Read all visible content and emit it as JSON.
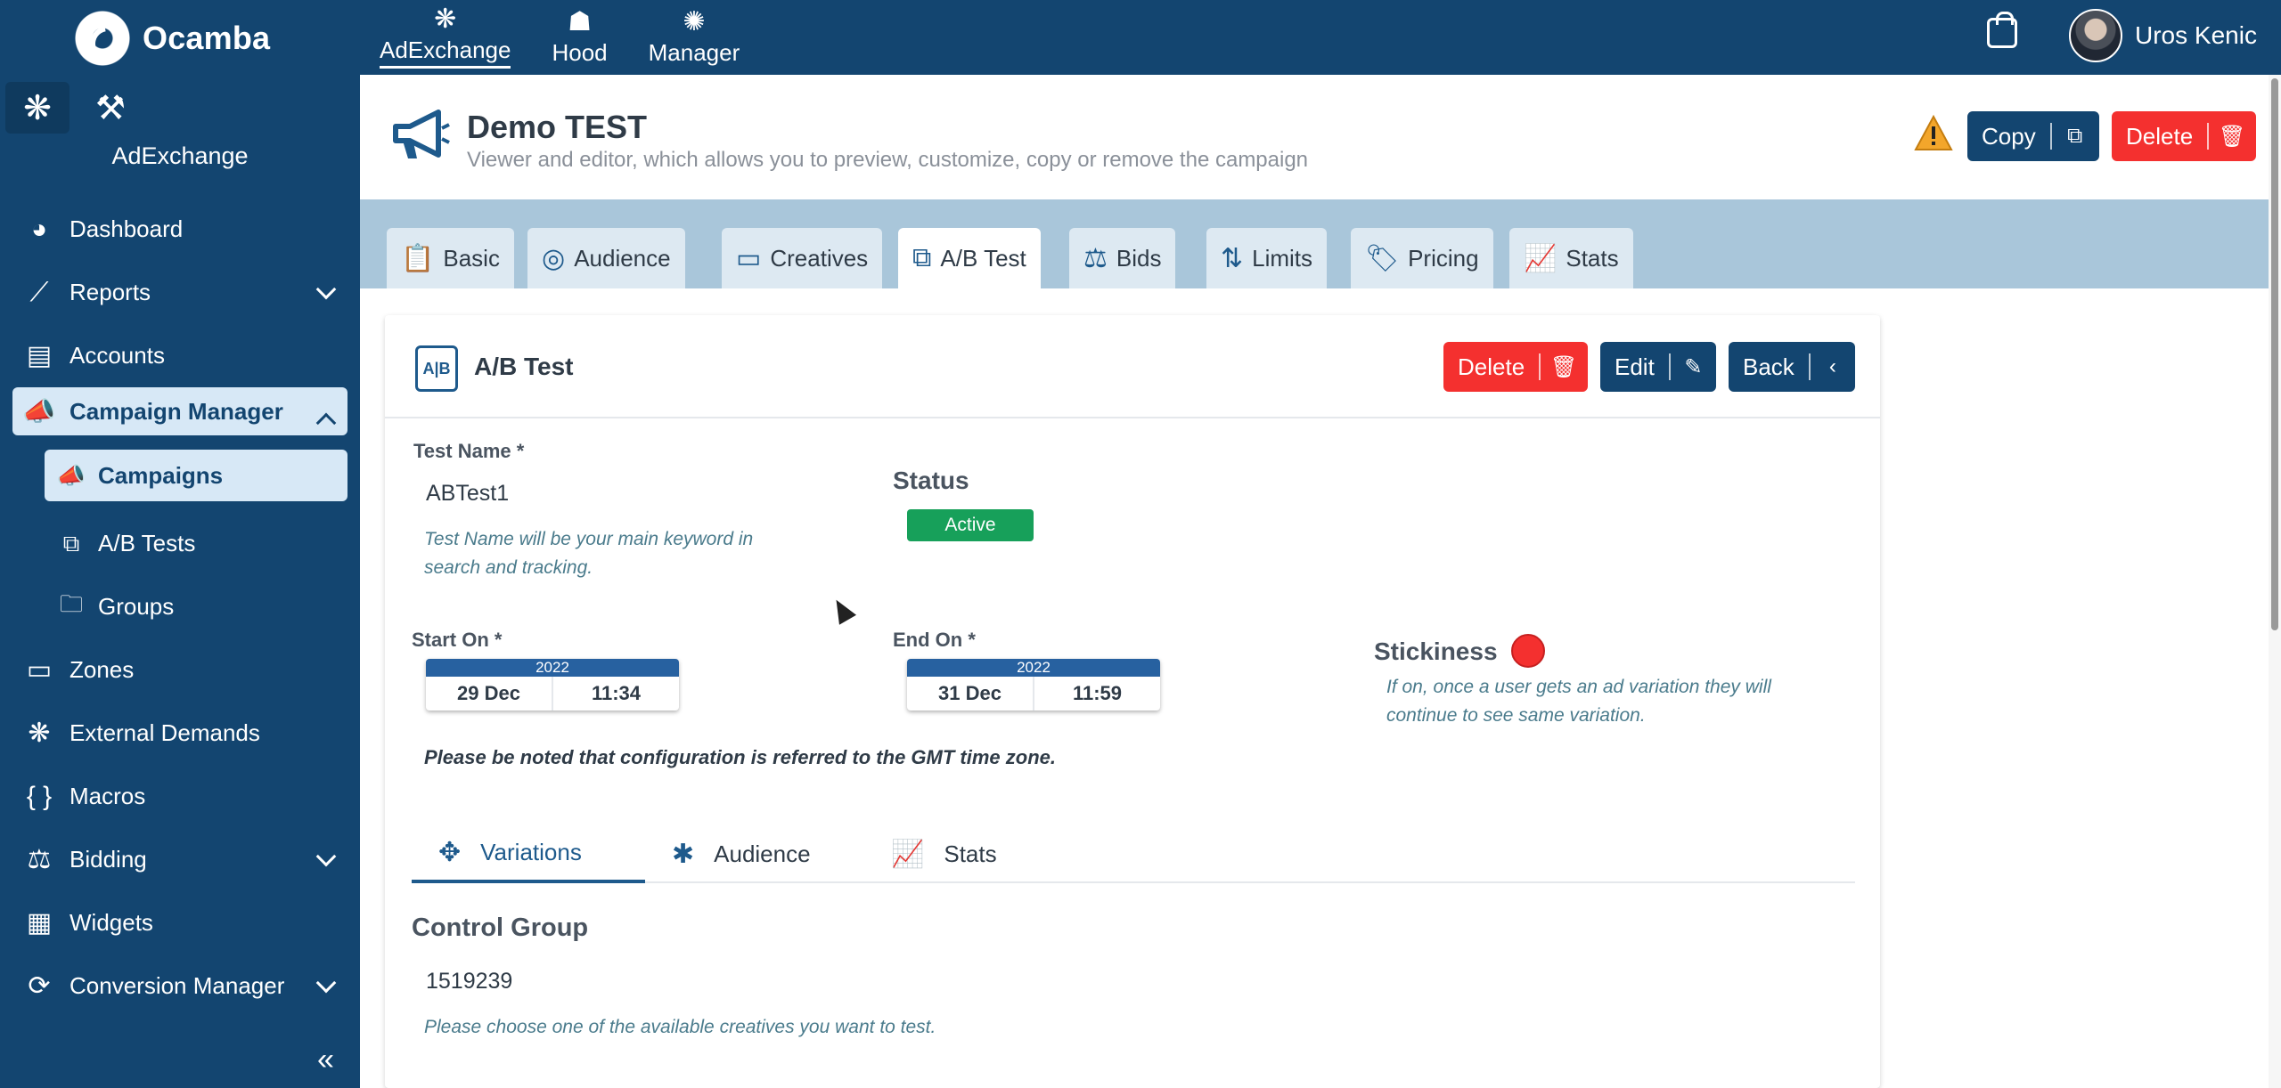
{
  "app": {
    "name": "Ocamba"
  },
  "top_nav": [
    {
      "label": "AdExchange",
      "icon": "network-icon",
      "active": true
    },
    {
      "label": "Hood",
      "icon": "hood-icon",
      "active": false
    },
    {
      "label": "Manager",
      "icon": "manager-icon",
      "active": false
    }
  ],
  "user": {
    "name": "Uros Kenic"
  },
  "sidebar": {
    "title": "AdExchange",
    "items": [
      {
        "label": "Dashboard",
        "icon": "dashboard-icon"
      },
      {
        "label": "Reports",
        "icon": "reports-icon"
      },
      {
        "label": "Accounts",
        "icon": "accounts-icon"
      },
      {
        "label": "Campaign Manager",
        "icon": "megaphone-icon"
      },
      {
        "label": "Campaigns",
        "icon": "megaphone-icon"
      },
      {
        "label": "A/B Tests",
        "icon": "ab-test-icon"
      },
      {
        "label": "Groups",
        "icon": "folder-icon"
      },
      {
        "label": "Zones",
        "icon": "pub-icon"
      },
      {
        "label": "External Demands",
        "icon": "network-icon"
      },
      {
        "label": "Macros",
        "icon": "braces-icon"
      },
      {
        "label": "Bidding",
        "icon": "gavel-icon"
      },
      {
        "label": "Widgets",
        "icon": "grid-icon"
      },
      {
        "label": "Conversion Manager",
        "icon": "conversion-icon"
      }
    ]
  },
  "header": {
    "title": "Demo TEST",
    "description": "Viewer and editor, which allows you to preview, customize, copy or remove the campaign",
    "copy_label": "Copy",
    "delete_label": "Delete"
  },
  "tabs": [
    {
      "label": "Basic",
      "icon": "clipboard-icon"
    },
    {
      "label": "Audience",
      "icon": "audience-icon"
    },
    {
      "label": "Creatives",
      "icon": "creatives-icon"
    },
    {
      "label": "A/B Test",
      "icon": "ab-test-icon",
      "active": true
    },
    {
      "label": "Bids",
      "icon": "gavel-icon"
    },
    {
      "label": "Limits",
      "icon": "limits-icon"
    },
    {
      "label": "Pricing",
      "icon": "price-tag-icon"
    },
    {
      "label": "Stats",
      "icon": "chart-icon"
    }
  ],
  "card": {
    "title": "A/B Test",
    "delete_label": "Delete",
    "edit_label": "Edit",
    "back_label": "Back",
    "test_name_label": "Test Name *",
    "test_name_value": "ABTest1",
    "test_name_hint": "Test Name will be your main keyword in search and tracking.",
    "status_label": "Status",
    "status_value": "Active",
    "start_label": "Start On *",
    "start": {
      "year": "2022",
      "date": "29 Dec",
      "time": "11:34"
    },
    "end_label": "End On *",
    "end": {
      "year": "2022",
      "date": "31 Dec",
      "time": "11:59"
    },
    "stickiness_label": "Stickiness",
    "stickiness_hint": "If on, once a user gets an ad variation they will continue to see same variation.",
    "timezone_note": "Please be noted that configuration is referred to the GMT time zone.",
    "subtabs": [
      {
        "label": "Variations",
        "active": true
      },
      {
        "label": "Audience"
      },
      {
        "label": "Stats"
      }
    ],
    "control_group_label": "Control Group",
    "control_group_value": "1519239",
    "control_group_hint": "Please choose one of the available creatives you want to test."
  },
  "colors": {
    "primary": "#134570",
    "danger": "#f4302f",
    "success": "#17a05a",
    "tab_bar": "#a9c6da"
  }
}
